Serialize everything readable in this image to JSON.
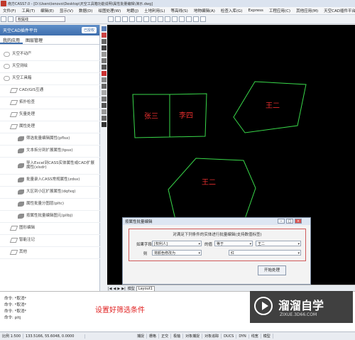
{
  "window": {
    "title": "南方CASS7.0 - [D:\\Users\\lenovo\\Desktop\\天空工具箱功能说明\\属性批量编辑\\演示.dwg]"
  },
  "menu": [
    "文件(F)",
    "工具(T)",
    "编辑(E)",
    "显示(V)",
    "数据(D)",
    "绘图处理(W)",
    "地籍(J)",
    "土地利用(L)",
    "等高线(S)",
    "地物编辑(A)",
    "检查入库(G)",
    "Express",
    "工程应用(C)",
    "其他应用(M)",
    "天空CAD插件平台"
  ],
  "toolbar": {
    "layer_select": "权属线"
  },
  "panel": {
    "title": "天空CAD插件平台",
    "button": "已授权",
    "tabs": [
      "我的应用",
      "图层管理"
    ],
    "items": [
      {
        "label": "天空不动产",
        "icon": "cloud-icon"
      },
      {
        "label": "天空测绘",
        "icon": "cloud-icon"
      },
      {
        "label": "天空工具箱",
        "icon": "cloud-icon"
      },
      {
        "label": "CAD/GIS互通",
        "icon": "paper-plane-icon"
      },
      {
        "label": "拓扑检查",
        "icon": "paper-plane-icon"
      },
      {
        "label": "矢量处理",
        "icon": "paper-plane-icon"
      },
      {
        "label": "属性处理",
        "icon": "paper-plane-icon"
      },
      {
        "label": "筛选批量编辑属性(pflsx)",
        "icon": "leaf-icon"
      },
      {
        "label": "文本拆分到扩展属性(tpsx)",
        "icon": "leaf-icon"
      },
      {
        "label": "导入Excel到CASS实体属性或CAD扩展属性(xlsdr)",
        "icon": "leaf-icon"
      },
      {
        "label": "批量录入CASS常规属性(zdsx)",
        "icon": "leaf-icon"
      },
      {
        "label": "大区到小区扩展属性(dqfxq)",
        "icon": "leaf-icon"
      },
      {
        "label": "属性批量分图层(pltc)",
        "icon": "leaf-icon"
      },
      {
        "label": "按属性批量编辑图元(pllbj)",
        "icon": "leaf-icon"
      },
      {
        "label": "图形编辑",
        "icon": "paper-plane-icon"
      },
      {
        "label": "智能注记",
        "icon": "paper-plane-icon"
      },
      {
        "label": "其他",
        "icon": "paper-plane-icon"
      }
    ]
  },
  "drawing": {
    "labels": [
      "张三",
      "李四",
      "王二",
      "王二"
    ],
    "colors": {
      "line": "#39d84a",
      "text": "#e52e2e",
      "bg": "#000000"
    }
  },
  "dialog": {
    "title": "按属性批量编辑",
    "header": "对满足下列条件的实体进行批量编辑(支持数值标签)",
    "if_label": "如果字段",
    "field": "[权利人]",
    "value_label": "的值",
    "operator": "等于",
    "value": "王二",
    "then_label": "则",
    "action": "将颜色修改为",
    "color": "红",
    "apply": "开始处理"
  },
  "layout_tabs": [
    "模型",
    "Layout1"
  ],
  "command": {
    "lines": [
      "*取消*",
      "*取消*",
      "*取消*",
      "pltj"
    ],
    "annotation": "设置好筛选条件"
  },
  "watermark": {
    "name": "溜溜自学",
    "url": "ZIXUE.3D66.COM"
  },
  "status": {
    "scale": "比例",
    "scale_value": "1:500",
    "coords": "133.5166, 55.6048, 0.0000",
    "modes": [
      "捕捉",
      "栅格",
      "正交",
      "极轴",
      "对象捕捉",
      "对象追踪",
      "DUCS",
      "DYN",
      "线宽",
      "模型"
    ]
  }
}
